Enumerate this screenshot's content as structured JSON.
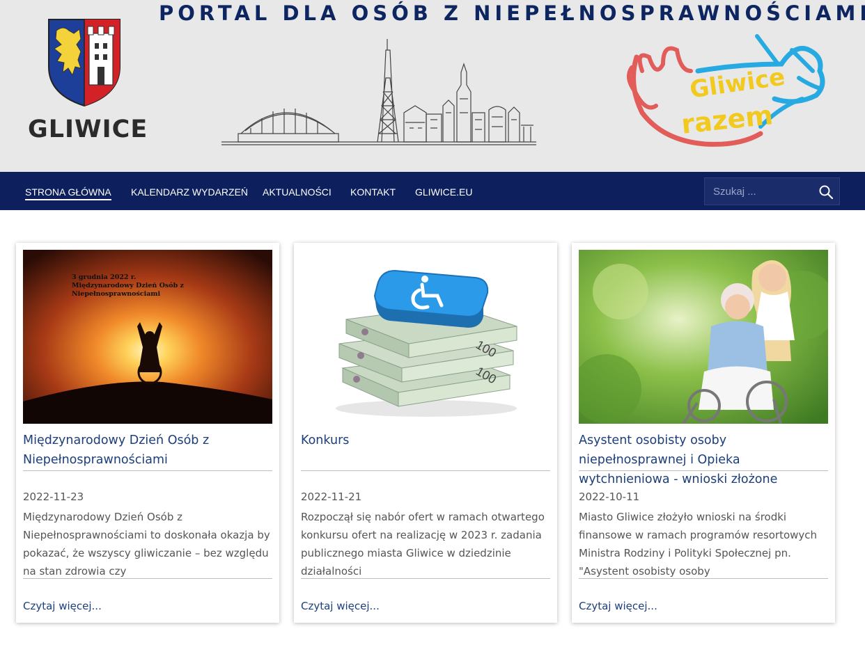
{
  "header": {
    "site_title": "PORTAL DLA OSÓB Z NIEPEŁNOSPRAWNOŚCIAMI",
    "city_name": "GLIWICE",
    "logo_text_line1": "Gliwice",
    "logo_text_line2": "razem"
  },
  "nav": {
    "items": [
      {
        "label": "STRONA GŁÓWNA",
        "active": true
      },
      {
        "label": "KALENDARZ WYDARZEŃ"
      },
      {
        "label": "AKTUALNOŚCI"
      },
      {
        "label": "KONTAKT"
      },
      {
        "label": "GLIWICE.EU"
      }
    ],
    "search": {
      "placeholder": "Szukaj ...",
      "icon": "search-icon"
    }
  },
  "cards": [
    {
      "image_caption_line1": "3 grudnia 2022 r.",
      "image_caption_line2": "Międzynarodowy Dzień Osób z Niepełnosprawnościami",
      "title": "Międzynarodowy Dzień Osób z Niepełnosprawnościami",
      "date": "2022-11-23",
      "excerpt": "Międzynarodowy Dzień Osób z Niepełnosprawnościami to doskonała okazja by pokazać, że wszyscy gliwiczanie – bez względu na stan zdrowia czy",
      "read_more": "Czytaj więcej..."
    },
    {
      "title": "Konkurs",
      "date": "2022-11-21",
      "excerpt": "Rozpoczął się nabór ofert w ramach otwartego konkursu ofert na realizację w 2023 r. zadania publicznego miasta Gliwice w dziedzinie działalności",
      "read_more": "Czytaj więcej..."
    },
    {
      "title": "Asystent osobisty osoby niepełnosprawnej i Opieka wytchnieniowa - wnioski złożone",
      "date": "2022-10-11",
      "excerpt": "Miasto Gliwice złożyło wnioski na środki finansowe w ramach programów resortowych Ministra Rodziny i Polityki Społecznej pn. \"Asystent osobisty osoby",
      "read_more": "Czytaj więcej..."
    }
  ],
  "colors": {
    "header_bg": "#e8e8e8",
    "nav_bg": "#0d1f5c",
    "title_color": "#0d2560",
    "link_color": "#1c3f7a"
  }
}
